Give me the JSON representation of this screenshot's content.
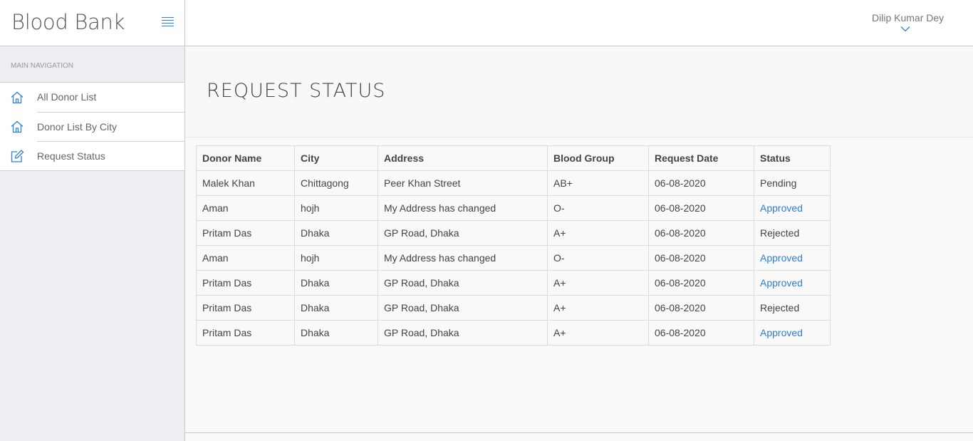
{
  "app": {
    "title": "Blood Bank"
  },
  "sidebar": {
    "header": "MAIN NAVIGATION",
    "items": [
      {
        "label": "All Donor List",
        "icon": "home-icon"
      },
      {
        "label": "Donor List By City",
        "icon": "home-icon"
      },
      {
        "label": "Request Status",
        "icon": "edit-icon"
      }
    ]
  },
  "topbar": {
    "user_name": "Dilip Kumar Dey"
  },
  "page": {
    "title": "REQUEST STATUS"
  },
  "table": {
    "headers": [
      "Donor Name",
      "City",
      "Address",
      "Blood Group",
      "Request Date",
      "Status"
    ],
    "rows": [
      [
        "Malek Khan",
        "Chittagong",
        "Peer Khan Street",
        "AB+",
        "06-08-2020",
        "Pending"
      ],
      [
        "Aman",
        "hojh",
        "My Address has changed",
        "O-",
        "06-08-2020",
        "Approved"
      ],
      [
        "Pritam Das",
        "Dhaka",
        "GP Road, Dhaka",
        "A+",
        "06-08-2020",
        "Rejected"
      ],
      [
        "Aman",
        "hojh",
        "My Address has changed",
        "O-",
        "06-08-2020",
        "Approved"
      ],
      [
        "Pritam Das",
        "Dhaka",
        "GP Road, Dhaka",
        "A+",
        "06-08-2020",
        "Approved"
      ],
      [
        "Pritam Das",
        "Dhaka",
        "GP Road, Dhaka",
        "A+",
        "06-08-2020",
        "Rejected"
      ],
      [
        "Pritam Das",
        "Dhaka",
        "GP Road, Dhaka",
        "A+",
        "06-08-2020",
        "Approved"
      ]
    ]
  },
  "colors": {
    "accent": "#2f7dd8",
    "approved": "#2f7dd8"
  }
}
